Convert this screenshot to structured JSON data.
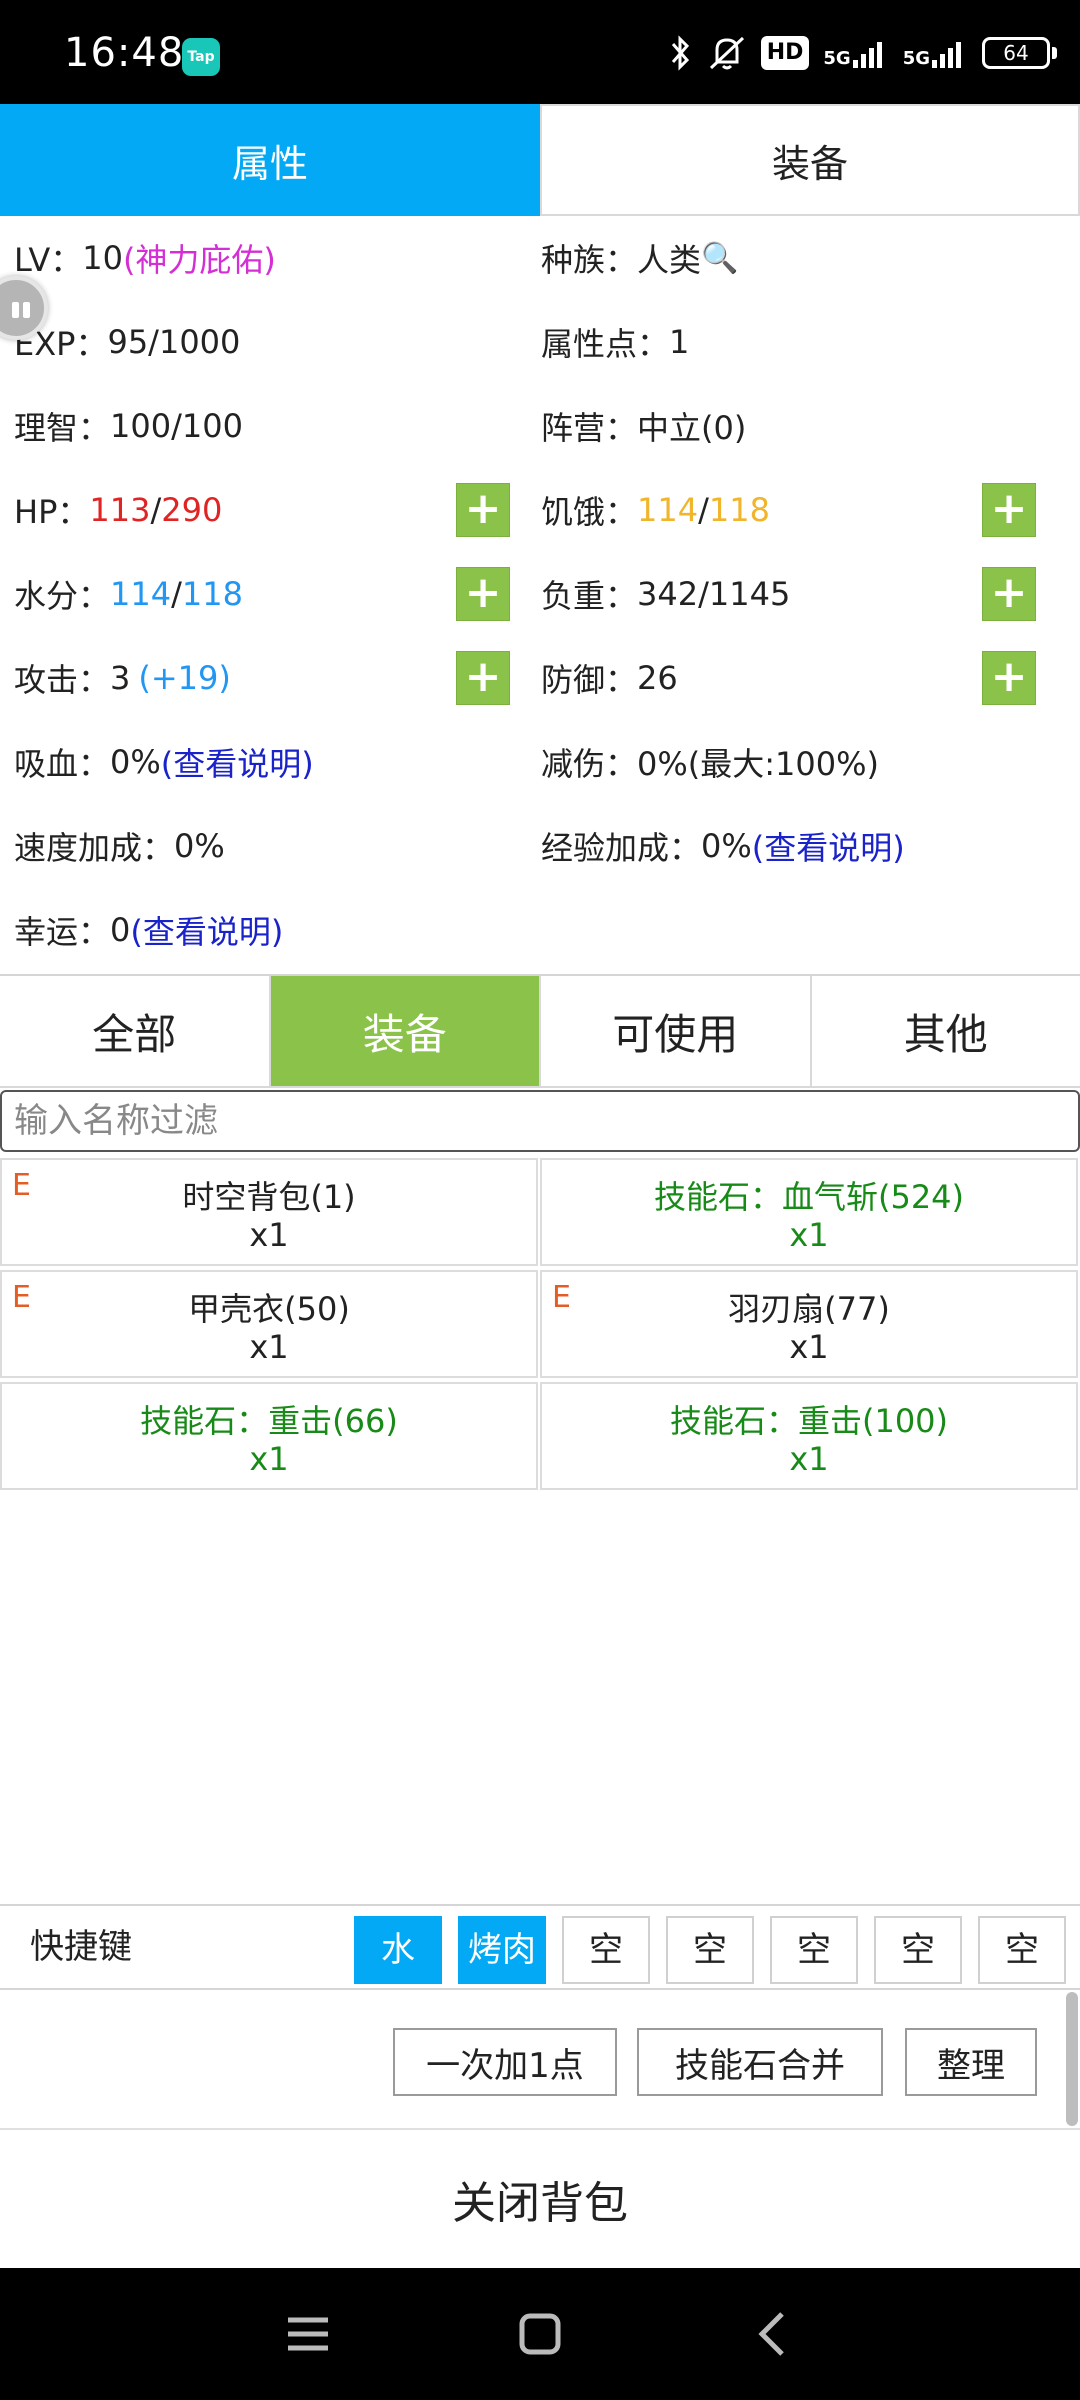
{
  "status_bar": {
    "time": "16:48",
    "app_badge": "Tap",
    "hd_label": "HD",
    "network_1": "5G",
    "network_2": "5G",
    "battery": "64",
    "icons": [
      "bluetooth-icon",
      "mute-icon",
      "hd-icon",
      "signal-icon",
      "signal-icon",
      "battery-icon"
    ]
  },
  "top_tabs": [
    {
      "label": "属性",
      "active": true
    },
    {
      "label": "装备",
      "active": false
    }
  ],
  "attributes": {
    "lv_label": "LV：",
    "lv_value": "10",
    "lv_bonus": "(神力庇佑)",
    "race_label": "种族：",
    "race_value": "人类",
    "exp_label": "EXP：",
    "exp_value": "95/1000",
    "points_label": "属性点：",
    "points_value": "1",
    "sanity_label": "理智：",
    "sanity_value": "100/100",
    "camp_label": "阵营：",
    "camp_value": "中立(0)",
    "hp_label": "HP：",
    "hp_current": "113",
    "hp_sep": "/",
    "hp_max": "290",
    "hunger_label": "饥饿：",
    "hunger_current": "114",
    "hunger_sep": "/",
    "hunger_max": "118",
    "water_label": "水分：",
    "water_current": "114",
    "water_sep": "/",
    "water_max": "118",
    "load_label": "负重：",
    "load_value": "342/1145",
    "attack_label": "攻击：",
    "attack_value": "3",
    "attack_bonus": "(+19)",
    "defense_label": "防御：",
    "defense_value": "26",
    "lifesteal_label": "吸血：",
    "lifesteal_value": "0%",
    "lifesteal_link": "(查看说明)",
    "dmg_reduce_label": "减伤：",
    "dmg_reduce_value": "0%(最大:100%)",
    "speed_label": "速度加成：",
    "speed_value": "0%",
    "exp_bonus_label": "经验加成：",
    "exp_bonus_value": "0%",
    "exp_bonus_link": "(查看说明)",
    "luck_label": "幸运：",
    "luck_value": "0",
    "luck_link": "(查看说明)",
    "plus_symbol": "+",
    "search_icon": "🔍"
  },
  "category_tabs": [
    {
      "label": "全部",
      "active": false
    },
    {
      "label": "装备",
      "active": true
    },
    {
      "label": "可使用",
      "active": false
    },
    {
      "label": "其他",
      "active": false
    }
  ],
  "filter": {
    "placeholder": "输入名称过滤",
    "value": ""
  },
  "items": [
    {
      "mark": "E",
      "name": "时空背包(1)",
      "qty": "x1",
      "style": "normal"
    },
    {
      "mark": "",
      "name": "技能石：血气斩(524)",
      "qty": "x1",
      "style": "green"
    },
    {
      "mark": "E",
      "name": "甲壳衣(50)",
      "qty": "x1",
      "style": "normal"
    },
    {
      "mark": "E",
      "name": "羽刃扇(77)",
      "qty": "x1",
      "style": "normal"
    },
    {
      "mark": "",
      "name": "技能石：重击(66)",
      "qty": "x1",
      "style": "green"
    },
    {
      "mark": "",
      "name": "技能石：重击(100)",
      "qty": "x1",
      "style": "green"
    }
  ],
  "shortcut": {
    "label": "快捷键",
    "slots": [
      "水",
      "烤肉",
      "空",
      "空",
      "空",
      "空",
      "空"
    ]
  },
  "actions": {
    "add_one": "一次加1点",
    "merge_stones": "技能石合并",
    "sort": "整理"
  },
  "close_label": "关闭背包",
  "colors": {
    "primary_blue": "#03a9f4",
    "accent_green": "#8bc34a",
    "hp_red": "#e02424",
    "hunger_gold": "#f0b52a",
    "water_blue": "#2196f3",
    "link_blue": "#1a23c9",
    "bonus_magenta": "#d42fd4",
    "skill_green": "#178a17",
    "equip_mark": "#e35e24"
  }
}
